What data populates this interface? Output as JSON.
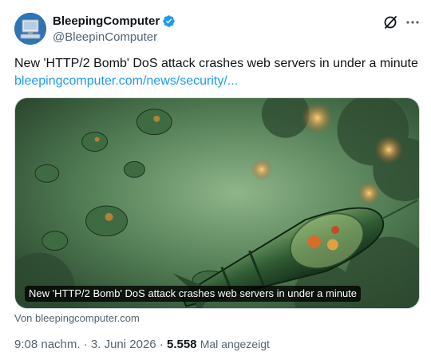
{
  "author": {
    "name": "BleepingComputer",
    "handle": "@BleepinComputer",
    "verified": true
  },
  "tweet": {
    "text": "New 'HTTP/2 Bomb' DoS attack crashes web servers in under a minute",
    "link": "bleepingcomputer.com/news/security/..."
  },
  "card": {
    "title": "New 'HTTP/2 Bomb' DoS attack crashes web servers in under a minute",
    "source": "Von bleepingcomputer.com",
    "image_description_icon": "rockets-illustration"
  },
  "meta": {
    "time": "9:08 nachm.",
    "separator": "·",
    "date": "3. Juni 2026",
    "views_count": "5.558",
    "views_label": "Mal angezeigt"
  },
  "icons": {
    "grok": "grok-icon",
    "more": "more-icon"
  },
  "colors": {
    "link": "#1d9bf0",
    "secondary_text": "#536471",
    "verified_badge": "#1d9bf0"
  }
}
